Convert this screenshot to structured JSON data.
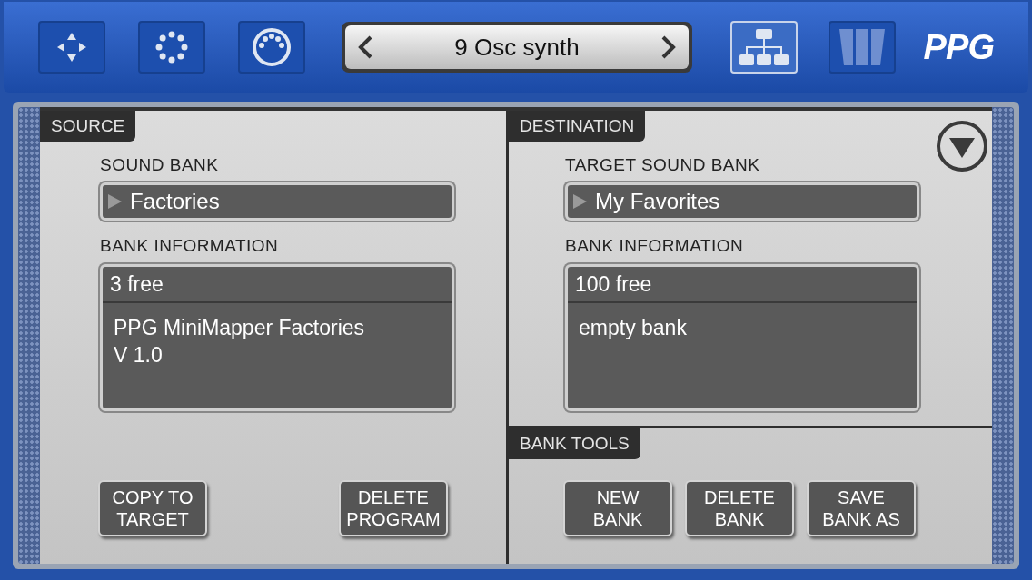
{
  "toolbar": {
    "left_buttons": [
      {
        "kind": "move",
        "selected": false
      },
      {
        "kind": "ring",
        "selected": false
      },
      {
        "kind": "midi",
        "selected": false
      }
    ],
    "program": {
      "name": "9 Osc synth"
    },
    "right_buttons": [
      {
        "kind": "hierarchy",
        "selected": true
      },
      {
        "kind": "bars",
        "selected": false
      }
    ],
    "logo": "PPG"
  },
  "source": {
    "tab": "SOURCE",
    "sound_bank_label": "SOUND BANK",
    "sound_bank": "Factories",
    "info_label": "BANK INFORMATION",
    "info_header": "3 free",
    "info_lines": [
      "PPG MiniMapper Factories",
      "V 1.0"
    ],
    "buttons": [
      [
        "COPY TO",
        "TARGET"
      ],
      [
        "DELETE",
        "PROGRAM"
      ]
    ]
  },
  "destination": {
    "tab": "DESTINATION",
    "sound_bank_label": "TARGET SOUND BANK",
    "sound_bank": "My Favorites",
    "info_label": "BANK INFORMATION",
    "info_header": "100 free",
    "info_lines": [
      "empty bank"
    ],
    "tools_tab": "BANK TOOLS",
    "buttons": [
      [
        "NEW",
        "BANK"
      ],
      [
        "DELETE",
        "BANK"
      ],
      [
        "SAVE",
        "BANK AS"
      ]
    ]
  }
}
